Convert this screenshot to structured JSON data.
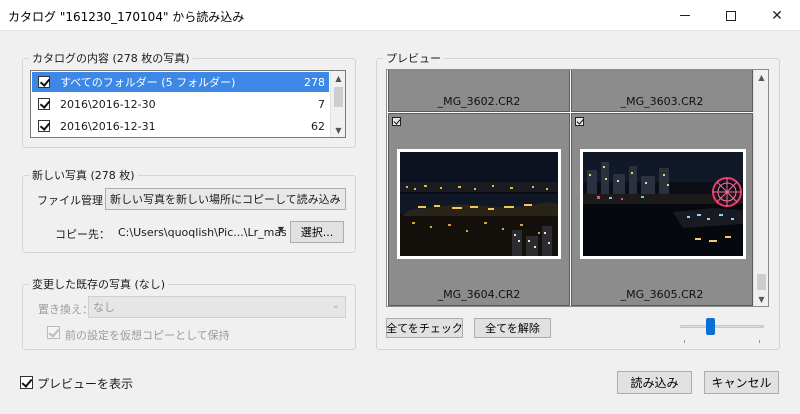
{
  "window": {
    "title": "カタログ \"161230_170104\" から読み込み"
  },
  "catalog": {
    "legend": "カタログの内容 (278 枚の写真)",
    "items": [
      {
        "label": "すべてのフォルダー (5 フォルダー)",
        "count": "278"
      },
      {
        "label": "2016\\2016-12-30",
        "count": "7"
      },
      {
        "label": "2016\\2016-12-31",
        "count": "62"
      }
    ]
  },
  "new_photos": {
    "legend": "新しい写真 (278 枚)",
    "file_handling_label": "ファイル管理：",
    "file_handling_value": "新しい写真を新しい場所にコピーして読み込み",
    "copy_to_label": "コピー先：",
    "copy_to_value": "C:\\Users\\quoqlish\\Pic...\\Lr_master",
    "choose_label": "選択..."
  },
  "existing_photos": {
    "legend": "変更した既存の写真 (なし)",
    "replace_label": "置き換え：",
    "replace_value": "なし",
    "preserve_label": "前の設定を仮想コピーとして保持"
  },
  "preview": {
    "legend": "プレビュー",
    "files": [
      "_MG_3602.CR2",
      "_MG_3603.CR2",
      "_MG_3604.CR2",
      "_MG_3605.CR2"
    ],
    "check_all": "全てをチェック",
    "uncheck_all": "全てを解除",
    "thumbnail_size": 0.35
  },
  "footer": {
    "show_preview": "プレビューを表示",
    "import": "読み込み",
    "cancel": "キャンセル"
  },
  "colors": {
    "selection": "#3d88e6",
    "grid_cell": "#8c8c8c",
    "slider_handle": "#0a6fd6"
  }
}
